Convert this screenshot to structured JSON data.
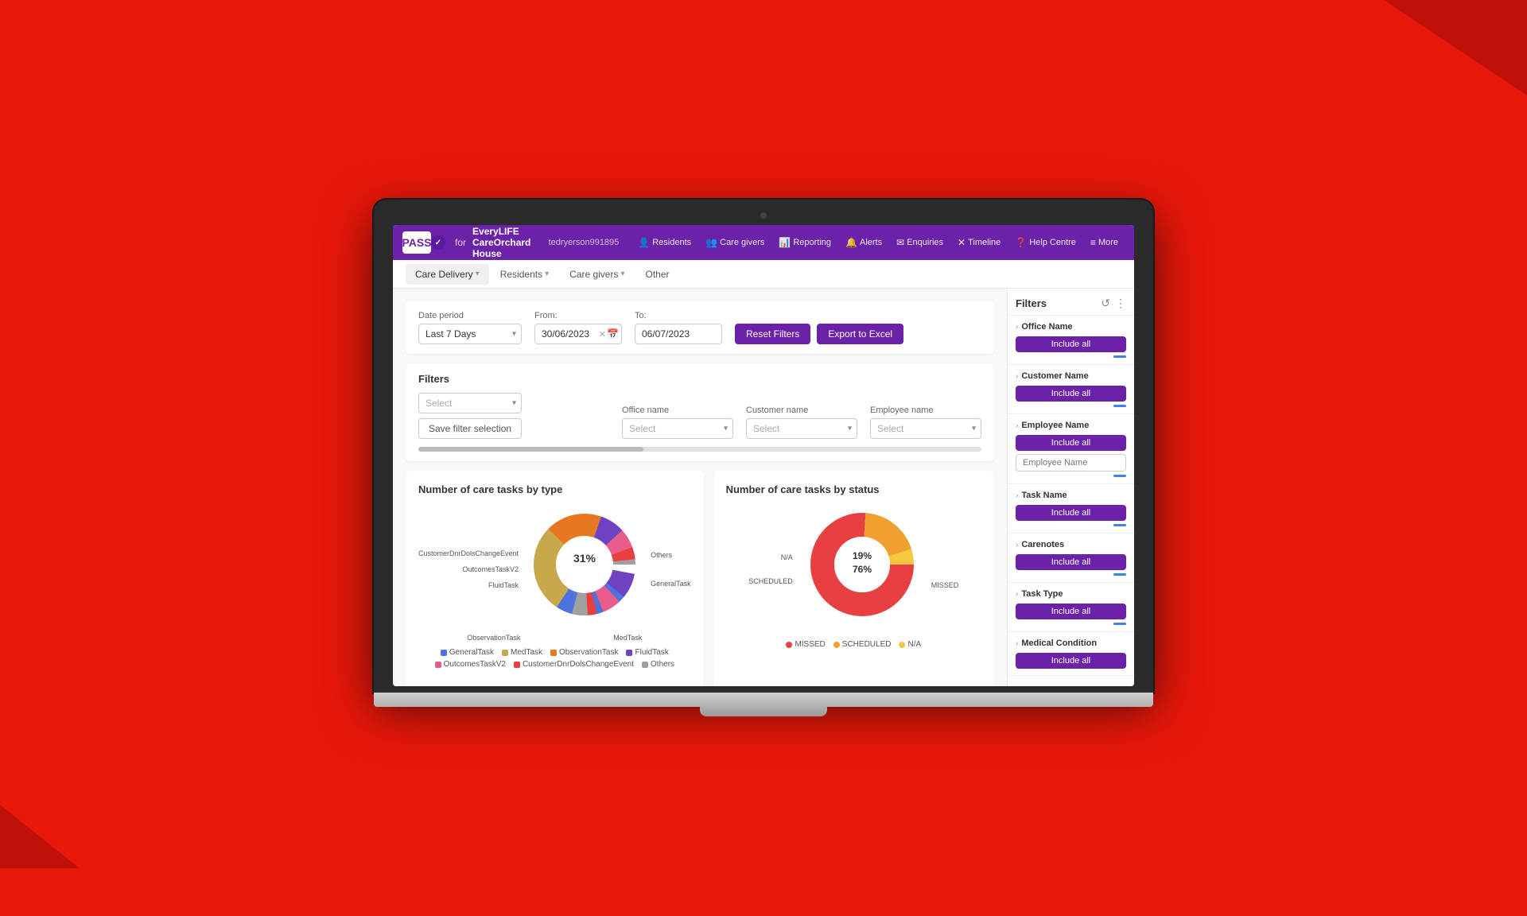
{
  "laptop": {
    "topnav": {
      "logo_text": "PASS",
      "for_text": "for",
      "company": "EveryLIFE CareOrchard House",
      "user": "tedryerson991895",
      "links": [
        {
          "label": "Residents",
          "icon": "👤",
          "key": "residents"
        },
        {
          "label": "Care givers",
          "icon": "👥",
          "key": "caregivers"
        },
        {
          "label": "Reporting",
          "icon": "📊",
          "key": "reporting"
        },
        {
          "label": "Alerts",
          "icon": "🔔",
          "key": "alerts"
        },
        {
          "label": "Enquiries",
          "icon": "✉",
          "key": "enquiries"
        },
        {
          "label": "Timeline",
          "icon": "✕",
          "key": "timeline"
        },
        {
          "label": "Help Centre",
          "icon": "❓",
          "key": "helpcentre"
        },
        {
          "label": "More",
          "icon": "≡",
          "key": "more"
        }
      ]
    },
    "subnav": {
      "items": [
        {
          "label": "Care Delivery",
          "has_dropdown": true,
          "active": true
        },
        {
          "label": "Residents",
          "has_dropdown": true,
          "active": false
        },
        {
          "label": "Care givers",
          "has_dropdown": true,
          "active": false
        },
        {
          "label": "Other",
          "has_dropdown": false,
          "active": false
        }
      ]
    },
    "filters_bar": {
      "date_period_label": "Date period",
      "date_period_value": "Last 7 Days",
      "from_label": "From:",
      "from_value": "30/06/2023",
      "to_label": "To:",
      "to_value": "06/07/2023",
      "reset_btn": "Reset Filters",
      "export_btn": "Export to Excel"
    },
    "filters_section": {
      "title": "Filters",
      "type_label": "",
      "type_placeholder": "Select",
      "office_name_label": "Office name",
      "office_name_placeholder": "Select",
      "customer_name_label": "Customer name",
      "customer_name_placeholder": "Select",
      "employee_name_label": "Employee name",
      "employee_name_placeholder": "Select",
      "save_filter_btn": "Save filter selection"
    },
    "chart1": {
      "title": "Number of care tasks by type",
      "segments": [
        {
          "label": "GeneralTask",
          "value": 31,
          "color": "#4e73df"
        },
        {
          "label": "MedTask",
          "value": 28,
          "color": "#c8a84b"
        },
        {
          "label": "ObservationTask",
          "value": 18,
          "color": "#e87722"
        },
        {
          "label": "FluidTask",
          "value": 8,
          "color": "#6f42c1"
        },
        {
          "label": "OutcomesTaskV2",
          "value": 6,
          "color": "#e95b8b"
        },
        {
          "label": "CustomerDnrDolsChangeEvent",
          "value": 4,
          "color": "#e84040"
        },
        {
          "label": "Others",
          "value": 5,
          "color": "#a0a0a0"
        }
      ],
      "labels_left": [
        "CustomerDnrDolsChangeEvent",
        "OutcomesTaskV2",
        "FluidTask"
      ],
      "labels_right": [
        "Others",
        "GeneralTask"
      ],
      "label_below_left": "ObservationTask",
      "label_below_right": "MedTask",
      "legend": [
        {
          "label": "GeneralTask",
          "color": "#4e73df"
        },
        {
          "label": "MedTask",
          "color": "#c8a84b"
        },
        {
          "label": "ObservationTask",
          "color": "#e87722"
        },
        {
          "label": "FluidTask",
          "color": "#6f42c1"
        },
        {
          "label": "OutcomesTaskV2",
          "color": "#e95b8b"
        },
        {
          "label": "CustomerDnrDolsChangeEvent",
          "color": "#e84040"
        },
        {
          "label": "Others",
          "color": "#a0a0a0"
        }
      ]
    },
    "chart2": {
      "title": "Number of care tasks by status",
      "segments": [
        {
          "label": "MISSED",
          "value": 76,
          "color": "#e84040"
        },
        {
          "label": "SCHEDULED",
          "value": 19,
          "color": "#f0a030"
        },
        {
          "label": "N/A",
          "value": 5,
          "color": "#f5c842"
        }
      ],
      "labels": [
        "N/A",
        "SCHEDULED",
        "MISSED"
      ],
      "legend": [
        {
          "label": "MISSED",
          "color": "#e84040"
        },
        {
          "label": "SCHEDULED",
          "color": "#f0a030"
        },
        {
          "label": "N/A",
          "color": "#f5c842"
        }
      ]
    },
    "right_panel": {
      "title": "Filters",
      "sections": [
        {
          "key": "office-name",
          "title": "Office Name",
          "btn_label": "Include all",
          "has_input": false
        },
        {
          "key": "customer-name",
          "title": "Customer Name",
          "btn_label": "Include all",
          "has_input": false
        },
        {
          "key": "employee-name",
          "title": "Employee Name",
          "btn_label": "Include all",
          "has_input": true,
          "input_placeholder": "Employee Name"
        },
        {
          "key": "task-name",
          "title": "Task Name",
          "btn_label": "Include all",
          "has_input": false
        },
        {
          "key": "carenotes",
          "title": "Carenotes",
          "btn_label": "Include all",
          "has_input": false
        },
        {
          "key": "task-type",
          "title": "Task Type",
          "btn_label": "Include all",
          "has_input": false
        },
        {
          "key": "medical-condition",
          "title": "Medical Condition",
          "btn_label": "Include all",
          "has_input": false
        }
      ]
    }
  }
}
